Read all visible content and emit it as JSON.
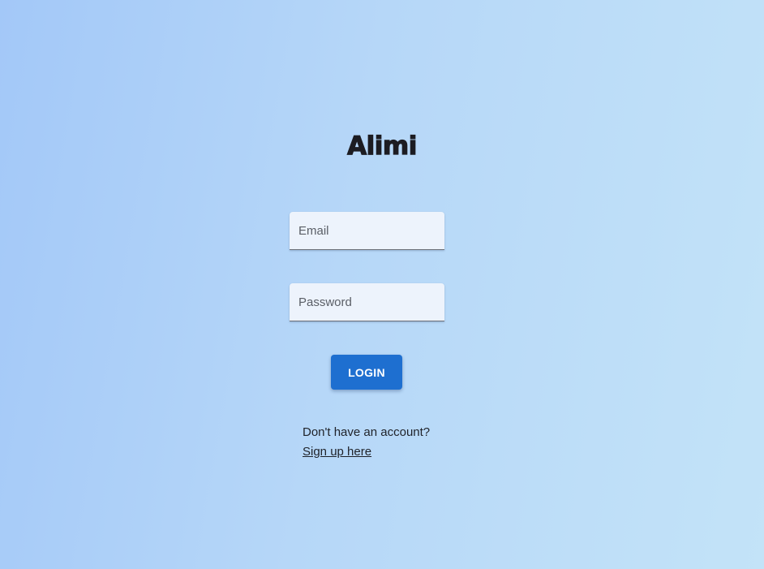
{
  "app": {
    "logo_text": "Alimi"
  },
  "login_form": {
    "email_placeholder": "Email",
    "password_placeholder": "Password",
    "login_label": "LOGIN"
  },
  "signup": {
    "prompt": "Don't have an account?",
    "link_label": "Sign up here"
  },
  "colors": {
    "background_start": "#a3c8f8",
    "background_end": "#c3e3f8",
    "input_background": "#edf3fc",
    "button_primary": "#1e6fd0",
    "text_dark": "#1f2229"
  }
}
